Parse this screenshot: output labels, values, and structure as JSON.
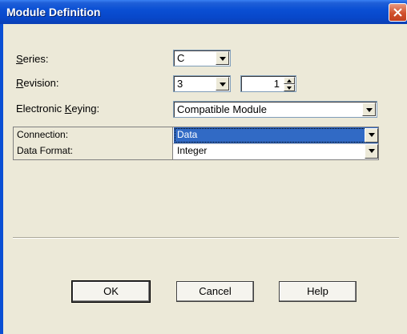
{
  "window": {
    "title": "Module Definition"
  },
  "fields": {
    "series": {
      "label_key": "S",
      "label_rest": "eries:",
      "value": "C"
    },
    "revision": {
      "label_key": "R",
      "label_rest": "evision:",
      "major": "3",
      "minor": "1"
    },
    "keying": {
      "label_pre": "Electronic ",
      "label_key": "K",
      "label_rest": "eying:",
      "value": "Compatible Module"
    }
  },
  "grid": {
    "rows": [
      {
        "name": "Connection:",
        "value": "Data"
      },
      {
        "name": "Data Format:",
        "value": "Integer"
      }
    ]
  },
  "buttons": {
    "ok": "OK",
    "cancel": "Cancel",
    "help": "Help"
  },
  "colors": {
    "titlebar": "#0a4fd4",
    "selection": "#316ac5",
    "face": "#ece9d8"
  }
}
